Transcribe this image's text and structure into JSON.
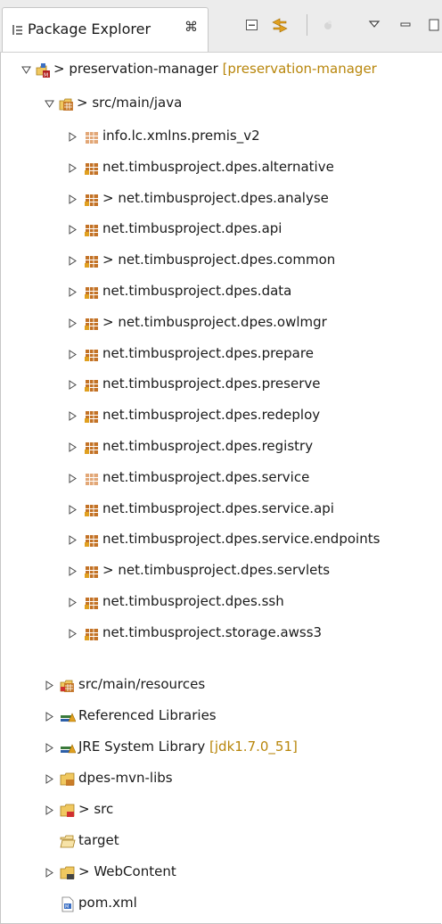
{
  "view": {
    "title": "Package Explorer",
    "close_glyph": "⌘"
  },
  "toolbar": {
    "buttons": [
      "collapse-all-icon",
      "link-with-editor-icon",
      "focus-icon",
      "view-menu-icon",
      "minimize-icon",
      "maximize-icon"
    ]
  },
  "tree": {
    "project": {
      "prefix": "> ",
      "label": "preservation-manager",
      "decoration": "[preservation-manager"
    },
    "src_main_java": {
      "prefix": "> ",
      "label": "src/main/java"
    },
    "packages": [
      {
        "prefix": "",
        "label": "info.lc.xmlns.premis_v2"
      },
      {
        "prefix": "",
        "label": "net.timbusproject.dpes.alternative"
      },
      {
        "prefix": "> ",
        "label": "net.timbusproject.dpes.analyse"
      },
      {
        "prefix": "",
        "label": "net.timbusproject.dpes.api"
      },
      {
        "prefix": "> ",
        "label": "net.timbusproject.dpes.common"
      },
      {
        "prefix": "",
        "label": "net.timbusproject.dpes.data"
      },
      {
        "prefix": "> ",
        "label": "net.timbusproject.dpes.owlmgr"
      },
      {
        "prefix": "",
        "label": "net.timbusproject.dpes.prepare"
      },
      {
        "prefix": "",
        "label": "net.timbusproject.dpes.preserve"
      },
      {
        "prefix": "",
        "label": "net.timbusproject.dpes.redeploy"
      },
      {
        "prefix": "",
        "label": "net.timbusproject.dpes.registry"
      },
      {
        "prefix": "",
        "label": "net.timbusproject.dpes.service"
      },
      {
        "prefix": "",
        "label": "net.timbusproject.dpes.service.api"
      },
      {
        "prefix": "",
        "label": "net.timbusproject.dpes.service.endpoints"
      },
      {
        "prefix": "> ",
        "label": "net.timbusproject.dpes.servlets"
      },
      {
        "prefix": "",
        "label": "net.timbusproject.dpes.ssh"
      },
      {
        "prefix": "",
        "label": "net.timbusproject.storage.awss3"
      }
    ],
    "src_main_resources": {
      "prefix": "",
      "label": "src/main/resources"
    },
    "referenced_libraries": {
      "label": "Referenced Libraries"
    },
    "jre": {
      "label": "JRE System Library",
      "decoration": "[jdk1.7.0_51]"
    },
    "dpes_mvn_libs": {
      "prefix": "",
      "label": "dpes-mvn-libs"
    },
    "src": {
      "prefix": "> ",
      "label": "src"
    },
    "target": {
      "label": "target"
    },
    "webcontent": {
      "prefix": "> ",
      "label": "WebContent"
    },
    "pom": {
      "label": "pom.xml"
    }
  },
  "colors": {
    "package": "#c06a1a",
    "folder": "#e8b84b",
    "decoration": "#b8860b",
    "library": "#3a7a3a"
  }
}
